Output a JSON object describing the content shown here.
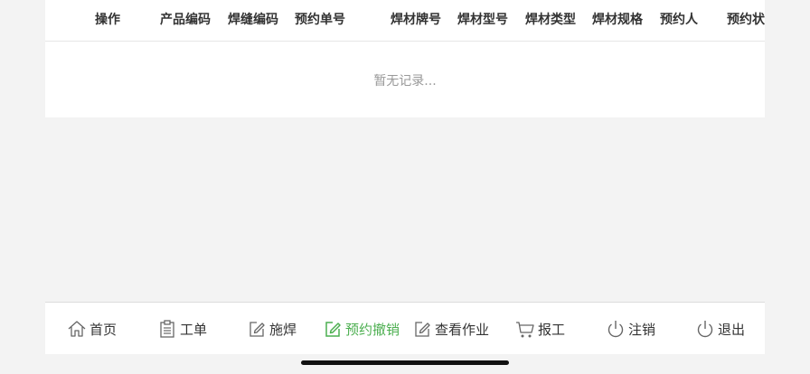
{
  "table": {
    "headers": [
      "操作",
      "产品编码",
      "焊缝编码",
      "预约单号",
      "焊材牌号",
      "焊材型号",
      "焊材类型",
      "焊材规格",
      "预约人",
      "预约状"
    ],
    "empty_text": "暂无记录..."
  },
  "tabbar": {
    "items": [
      {
        "label": "首页",
        "icon": "home-icon"
      },
      {
        "label": "工单",
        "icon": "clipboard-icon"
      },
      {
        "label": "施焊",
        "icon": "edit-icon"
      },
      {
        "label": "预约撤销",
        "icon": "edit-icon",
        "active": true
      },
      {
        "label": "查看作业",
        "icon": "edit-icon"
      },
      {
        "label": "报工",
        "icon": "cart-icon"
      },
      {
        "label": "注销",
        "icon": "power-icon"
      },
      {
        "label": "退出",
        "icon": "power-icon"
      }
    ]
  },
  "colors": {
    "active": "#4caf50",
    "text": "#333333",
    "muted": "#999999"
  }
}
